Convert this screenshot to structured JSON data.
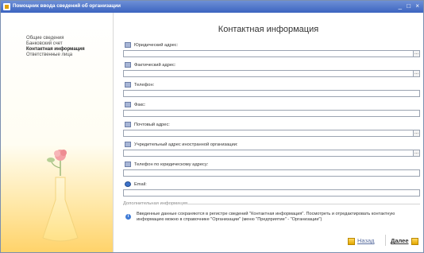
{
  "window": {
    "title": "Помощник ввода сведений об организации",
    "controls": "_ □ ×"
  },
  "sidebar": {
    "items": [
      {
        "label": "Общие сведения",
        "active": false
      },
      {
        "label": "Банковский счет",
        "active": false
      },
      {
        "label": "Контактная информация",
        "active": true
      },
      {
        "label": "Ответственные лица",
        "active": false
      }
    ]
  },
  "main": {
    "title": "Контактная информация",
    "fields": [
      {
        "label": "Юридический адрес:",
        "icon": "address-card-icon",
        "value": "",
        "has_select_button": true
      },
      {
        "label": "Фактический адрес:",
        "icon": "address-card-icon",
        "value": "",
        "has_select_button": true
      },
      {
        "label": "Телефон:",
        "icon": "phone-icon",
        "value": "",
        "has_select_button": false
      },
      {
        "label": "Факс:",
        "icon": "fax-icon",
        "value": "",
        "has_select_button": false
      },
      {
        "label": "Почтовый адрес:",
        "icon": "address-card-icon",
        "value": "",
        "has_select_button": true
      },
      {
        "label": "Учредительный адрес иностранной организации:",
        "icon": "address-card-icon",
        "value": "",
        "has_select_button": true
      },
      {
        "label": "Телефон по юридическому адресу:",
        "icon": "phone-icon",
        "value": "",
        "has_select_button": false
      },
      {
        "label": "Email:",
        "icon": "email-icon",
        "value": "",
        "has_select_button": false
      }
    ],
    "select_button_label": "...",
    "additional_section": "Дополнительная информация",
    "info_icon": "i",
    "info_text": "Введенные данные сохраняются в регистре сведений \"Контактная информация\". Посмотреть и отредактировать контактную информацию можно в справочнике \"Организации\" (меню \"Предприятие\" - \"Организации\")"
  },
  "footer": {
    "back_label": "Назад",
    "next_label": "Далее"
  }
}
